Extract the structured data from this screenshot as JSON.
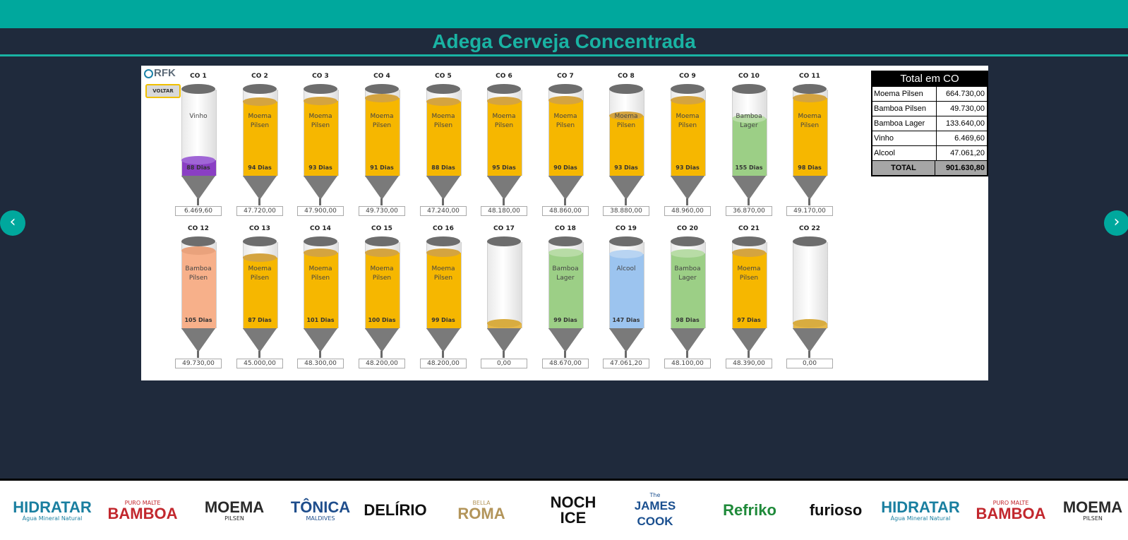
{
  "header": {
    "title": "Adega Cerveja Concentrada"
  },
  "panel": {
    "logo": "RFK",
    "back_label": "VOLTAR"
  },
  "tanks": [
    {
      "id": "CO 1",
      "beer": "Vinho",
      "days": "88 Dias",
      "volume": "6.469,60",
      "fill": 0.18,
      "color": "#8a3fc4",
      "top": "#a066d6"
    },
    {
      "id": "CO 2",
      "beer": "Moema Pilsen",
      "days": "94 Dias",
      "volume": "47.720,00",
      "fill": 0.86,
      "color": "#f6b700",
      "top": "#d4a440"
    },
    {
      "id": "CO 3",
      "beer": "Moema Pilsen",
      "days": "93 Dias",
      "volume": "47.900,00",
      "fill": 0.87,
      "color": "#f6b700",
      "top": "#d4a440"
    },
    {
      "id": "CO 4",
      "beer": "Moema Pilsen",
      "days": "91 Dias",
      "volume": "49.730,00",
      "fill": 0.9,
      "color": "#f6b700",
      "top": "#d4a440"
    },
    {
      "id": "CO 5",
      "beer": "Moema Pilsen",
      "days": "88 Dias",
      "volume": "47.240,00",
      "fill": 0.86,
      "color": "#f6b700",
      "top": "#d4a440"
    },
    {
      "id": "CO 6",
      "beer": "Moema Pilsen",
      "days": "95 Dias",
      "volume": "48.180,00",
      "fill": 0.87,
      "color": "#f6b700",
      "top": "#d4a440"
    },
    {
      "id": "CO 7",
      "beer": "Moema Pilsen",
      "days": "90 Dias",
      "volume": "48.860,00",
      "fill": 0.88,
      "color": "#f6b700",
      "top": "#d4a440"
    },
    {
      "id": "CO 8",
      "beer": "Moema Pilsen",
      "days": "93 Dias",
      "volume": "38.880,00",
      "fill": 0.7,
      "color": "#f6b700",
      "top": "#d4a440"
    },
    {
      "id": "CO 9",
      "beer": "Moema Pilsen",
      "days": "93 Dias",
      "volume": "48.960,00",
      "fill": 0.88,
      "color": "#f6b700",
      "top": "#d4a440"
    },
    {
      "id": "CO 10",
      "beer": "Bamboa Lager",
      "days": "155 Dias",
      "volume": "36.870,00",
      "fill": 0.66,
      "color": "#9ccf86",
      "top": "#b8dca6"
    },
    {
      "id": "CO 11",
      "beer": "Moema Pilsen",
      "days": "98 Dias",
      "volume": "49.170,00",
      "fill": 0.9,
      "color": "#f6b700",
      "top": "#d4a440"
    },
    {
      "id": "CO 12",
      "beer": "Bamboa Pilsen",
      "days": "105 Dias",
      "volume": "49.730,00",
      "fill": 0.9,
      "color": "#f7b08a",
      "top": "#e9a27c"
    },
    {
      "id": "CO 13",
      "beer": "Moema Pilsen",
      "days": "87 Dias",
      "volume": "45.000,00",
      "fill": 0.82,
      "color": "#f6b700",
      "top": "#d4a440"
    },
    {
      "id": "CO 14",
      "beer": "Moema Pilsen",
      "days": "101 Dias",
      "volume": "48.300,00",
      "fill": 0.88,
      "color": "#f6b700",
      "top": "#d4a440"
    },
    {
      "id": "CO 15",
      "beer": "Moema Pilsen",
      "days": "100 Dias",
      "volume": "48.200,00",
      "fill": 0.88,
      "color": "#f6b700",
      "top": "#d4a440"
    },
    {
      "id": "CO 16",
      "beer": "Moema Pilsen",
      "days": "99 Dias",
      "volume": "48.200,00",
      "fill": 0.88,
      "color": "#f6b700",
      "top": "#d4a440"
    },
    {
      "id": "CO 17",
      "beer": "",
      "days": "",
      "volume": "0,00",
      "fill": 0.06,
      "color": "#e6b84a",
      "top": "#d8ac40"
    },
    {
      "id": "CO 18",
      "beer": "Bamboa Lager",
      "days": "99 Dias",
      "volume": "48.670,00",
      "fill": 0.88,
      "color": "#9ccf86",
      "top": "#b8dca6"
    },
    {
      "id": "CO 19",
      "beer": "Alcool",
      "days": "147 Dias",
      "volume": "47.061,20",
      "fill": 0.86,
      "color": "#9cc4ef",
      "top": "#b8d4f2"
    },
    {
      "id": "CO 20",
      "beer": "Bamboa Lager",
      "days": "98 Dias",
      "volume": "48.100,00",
      "fill": 0.87,
      "color": "#9ccf86",
      "top": "#b8dca6"
    },
    {
      "id": "CO 21",
      "beer": "Moema Pilsen",
      "days": "97 Dias",
      "volume": "48.390,00",
      "fill": 0.88,
      "color": "#f6b700",
      "top": "#d4a440"
    },
    {
      "id": "CO 22",
      "beer": "",
      "days": "",
      "volume": "0,00",
      "fill": 0.06,
      "color": "#e6b84a",
      "top": "#d8ac40"
    }
  ],
  "summary": {
    "title": "Total em CO",
    "rows": [
      {
        "name": "Moema Pilsen",
        "value": "664.730,00"
      },
      {
        "name": "Bamboa Pilsen",
        "value": "49.730,00"
      },
      {
        "name": "Bamboa Lager",
        "value": "133.640,00"
      },
      {
        "name": "Vinho",
        "value": "6.469,60"
      },
      {
        "name": "Alcool",
        "value": "47.061,20"
      }
    ],
    "total_label": "TOTAL",
    "total_value": "901.630,80"
  },
  "nav": {
    "prev_icon": "chevron-left-icon",
    "next_icon": "chevron-right-icon"
  },
  "brands": [
    {
      "name": "HIDRATAR",
      "sub": "Água Mineral Natural",
      "color": "#1a7fa0"
    },
    {
      "name": "BAMBOA",
      "sub": "PURO MALTE",
      "color": "#c2272d"
    },
    {
      "name": "MOEMA",
      "sub": "PILSEN",
      "color": "#2a2a2a"
    },
    {
      "name": "TÔNICA",
      "sub": "MALDIVES",
      "color": "#1f4e8c"
    },
    {
      "name": "DELÍRIO",
      "sub": "",
      "color": "#111111"
    },
    {
      "name": "ROMA",
      "sub": "BELLA",
      "color": "#b3955a"
    },
    {
      "name": "NOCH ICE",
      "sub": "",
      "color": "#111111"
    },
    {
      "name": "JAMES COOK",
      "sub": "The",
      "color": "#1a4f8f"
    },
    {
      "name": "Refriko",
      "sub": "",
      "color": "#1f8a3a"
    },
    {
      "name": "furioso",
      "sub": "",
      "color": "#111111"
    },
    {
      "name": "HIDRATAR",
      "sub": "Água Mineral Natural",
      "color": "#1a7fa0"
    },
    {
      "name": "BAMBOA",
      "sub": "PURO MALTE",
      "color": "#c2272d"
    },
    {
      "name": "MOEMA",
      "sub": "PILSEN",
      "color": "#2a2a2a"
    }
  ]
}
